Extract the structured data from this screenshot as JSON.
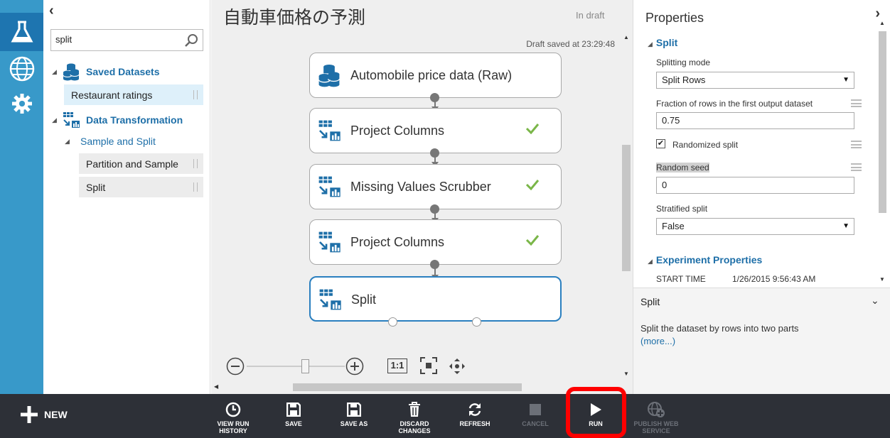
{
  "left_nav": {
    "items": [
      {
        "name": "experiments",
        "active": true
      },
      {
        "name": "web-services",
        "active": false
      },
      {
        "name": "settings",
        "active": false
      }
    ]
  },
  "palette": {
    "collapse_glyph": "‹",
    "search": {
      "value": "split"
    },
    "tree": {
      "saved_datasets": "Saved Datasets",
      "restaurant_ratings": "Restaurant ratings",
      "data_transformation": "Data Transformation",
      "sample_and_split": "Sample and Split",
      "partition_and_sample": "Partition and Sample",
      "split": "Split"
    }
  },
  "canvas": {
    "title": "自動車価格の予測",
    "status": "In draft",
    "saved_text": "Draft saved at 23:29:48",
    "nodes": [
      {
        "label": "Automobile price data (Raw)",
        "check": false
      },
      {
        "label": "Project Columns",
        "check": true
      },
      {
        "label": "Missing Values Scrubber",
        "check": true
      },
      {
        "label": "Project Columns",
        "check": true
      },
      {
        "label": "Split",
        "check": false
      }
    ],
    "zoom_labels": {
      "actual_size": "1:1"
    }
  },
  "properties": {
    "title": "Properties",
    "section_split": "Split",
    "splitting_mode_label": "Splitting mode",
    "splitting_mode_value": "Split Rows",
    "fraction_label": "Fraction of rows in the first output dataset",
    "fraction_value": "0.75",
    "randomized_label": "Randomized split",
    "randomized_checked": true,
    "seed_label": "Random seed",
    "seed_value": "0",
    "stratified_label": "Stratified split",
    "stratified_value": "False",
    "section_experiment": "Experiment Properties",
    "start_time_label": "START TIME",
    "start_time_value": "1/26/2015 9:56:43 AM"
  },
  "help": {
    "title": "Split",
    "description": "Split the dataset by rows into two parts",
    "more": "(more...)"
  },
  "toolbar": {
    "new": "NEW",
    "view_run_history": [
      "VIEW RUN",
      "HISTORY"
    ],
    "save": "SAVE",
    "save_as": "SAVE AS",
    "discard": [
      "DISCARD",
      "CHANGES"
    ],
    "refresh": "REFRESH",
    "cancel": "CANCEL",
    "run": "RUN",
    "publish": [
      "PUBLISH WEB",
      "SERVICE"
    ]
  },
  "colors": {
    "accent": "#3899c9",
    "link": "#1e6fa8",
    "highlight": "#ff0000",
    "check": "#7ab648",
    "toolbar": "#2d3037"
  }
}
